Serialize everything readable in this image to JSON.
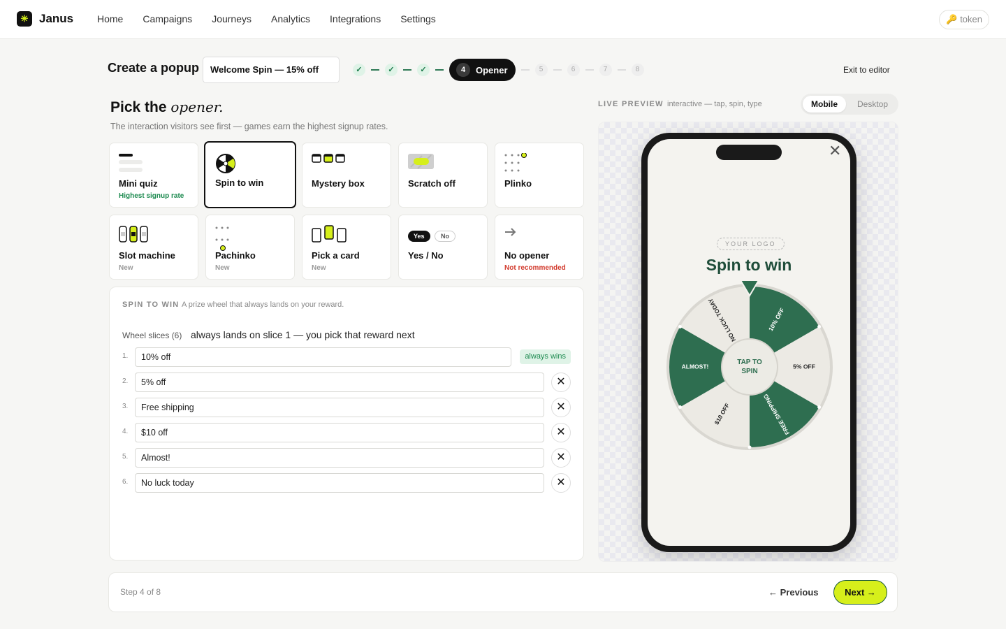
{
  "app": {
    "brand": "Janus",
    "logo_glyph": "✳"
  },
  "nav": {
    "items": [
      "Home",
      "Campaigns",
      "Journeys",
      "Analytics",
      "Integrations",
      "Settings"
    ],
    "token_label": "🔑 token"
  },
  "header": {
    "title": "Create a popup",
    "popup_name": "Welcome Spin — 15% off",
    "steps": {
      "done_mark": "✓",
      "active_number": "4",
      "active_label": "Opener",
      "future": [
        "5",
        "6",
        "7",
        "8"
      ]
    },
    "exit_label": "Exit to editor"
  },
  "opener": {
    "title_strong": "Pick the",
    "title_em": "opener.",
    "subtitle": "The interaction visitors see first — games earn the highest signup rates.",
    "cards": [
      {
        "label": "Mini quiz",
        "badge": "Highest signup rate",
        "icon": "quiz-icon"
      },
      {
        "label": "Spin to win",
        "badge": "",
        "icon": "wheel-icon",
        "selected": true
      },
      {
        "label": "Mystery box",
        "badge": "",
        "icon": "boxes-icon"
      },
      {
        "label": "Scratch off",
        "badge": "",
        "icon": "scratch-icon"
      },
      {
        "label": "Plinko",
        "badge": "",
        "icon": "plinko-icon"
      },
      {
        "label": "Slot machine",
        "badge": "New",
        "icon": "slots-icon"
      },
      {
        "label": "Pachinko",
        "badge": "New",
        "icon": "pachinko-icon"
      },
      {
        "label": "Pick a card",
        "badge": "New",
        "icon": "cards-icon"
      },
      {
        "label": "Yes / No",
        "badge": "",
        "icon": "yes-no-icon",
        "yes": "Yes",
        "no": "No"
      },
      {
        "label": "No opener",
        "badge": "Not recommended",
        "icon": "arrow-right-icon"
      }
    ]
  },
  "config": {
    "section_label": "SPIN TO WIN",
    "section_desc": "A prize wheel that always lands on your reward.",
    "slices_label": "Wheel slices (6)",
    "slices_note": "always lands on slice 1 — you pick that reward next",
    "always_wins": "always wins",
    "remove_glyph": "✕",
    "slices": [
      {
        "index": "1.",
        "value": "10% off"
      },
      {
        "index": "2.",
        "value": "5% off"
      },
      {
        "index": "3.",
        "value": "Free shipping"
      },
      {
        "index": "4.",
        "value": "$10 off"
      },
      {
        "index": "5.",
        "value": "Almost!"
      },
      {
        "index": "6.",
        "value": "No luck today"
      }
    ]
  },
  "preview": {
    "label": "LIVE PREVIEW",
    "desc": "interactive — tap, spin, type",
    "modes": [
      "Mobile",
      "Desktop"
    ],
    "active_mode": "Mobile",
    "close_glyph": "✕",
    "your_logo": "YOUR LOGO",
    "spin_title": "Spin to win",
    "wheel_labels": [
      "10% OFF",
      "5% OFF",
      "FREE SHIPPING",
      "$10 OFF",
      "ALMOST!",
      "NO LUCK TODAY"
    ],
    "center_line1": "TAP TO",
    "center_line2": "SPIN",
    "colors": {
      "green": "#2e6e50",
      "cream": "#eceae4",
      "accent": "#d6ef1b"
    }
  },
  "footer": {
    "step_text": "Step 4 of 8",
    "prev_label": "← Previous",
    "next_label": "Next →"
  }
}
